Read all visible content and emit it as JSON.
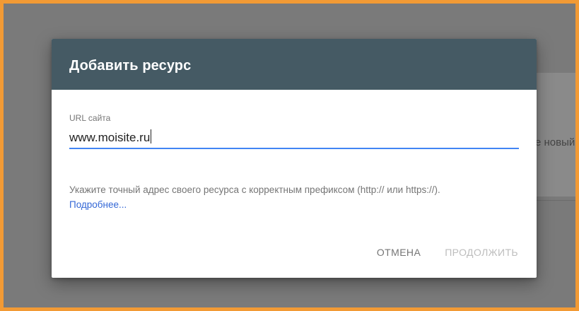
{
  "background": {
    "card_text": "е новый"
  },
  "dialog": {
    "title": "Добавить ресурс",
    "field": {
      "label": "URL сайта",
      "value": "www.moisite.ru"
    },
    "hint": "Укажите точный адрес своего ресурса с корректным префиксом (http:// или https://).",
    "more_link": "Подробнее...",
    "cancel_label": "ОТМЕНА",
    "continue_label": "ПРОДОЛЖИТЬ"
  },
  "colors": {
    "header_bg": "#455a64",
    "accent": "#4285f4",
    "link": "#3367d6",
    "frame_border": "#f29a35",
    "overlay": "#7a7a7a"
  }
}
